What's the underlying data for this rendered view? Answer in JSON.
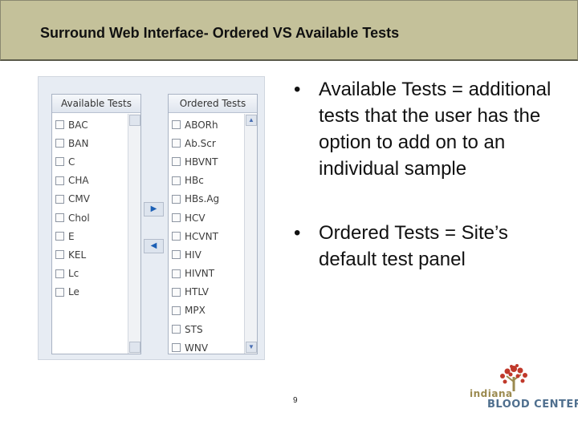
{
  "slide": {
    "title": "Surround Web Interface- Ordered VS Available Tests",
    "page_number": "9"
  },
  "available_panel": {
    "header": "Available Tests",
    "items": [
      "BAC",
      "BAN",
      "C",
      "CHA",
      "CMV",
      "Chol",
      "E",
      "KEL",
      "Lc",
      "Le"
    ]
  },
  "ordered_panel": {
    "header": "Ordered Tests",
    "items": [
      "ABORh",
      "Ab.Scr",
      "HBVNT",
      "HBc",
      "HBs.Ag",
      "HCV",
      "HCVNT",
      "HIV",
      "HIVNT",
      "HTLV",
      "MPX",
      "STS",
      "WNV"
    ]
  },
  "controls": {
    "move_right_icon": "triangle-right-icon",
    "move_left_icon": "triangle-left-icon"
  },
  "bullets": [
    {
      "text": "Available Tests = additional tests that the user has the option to add on to an individual sample"
    },
    {
      "text": "Ordered Tests = Site’s default test panel"
    }
  ],
  "logo": {
    "line1": "indiana",
    "line2": "BLOOD CENTER"
  },
  "colors": {
    "title_bar": "#c4c19a",
    "panel_background": "#e7ecf3",
    "arrow_blue": "#1b5fb5",
    "logo_red": "#c0392b",
    "logo_gold": "#9b8a4f",
    "logo_blue": "#4f6f8e"
  }
}
